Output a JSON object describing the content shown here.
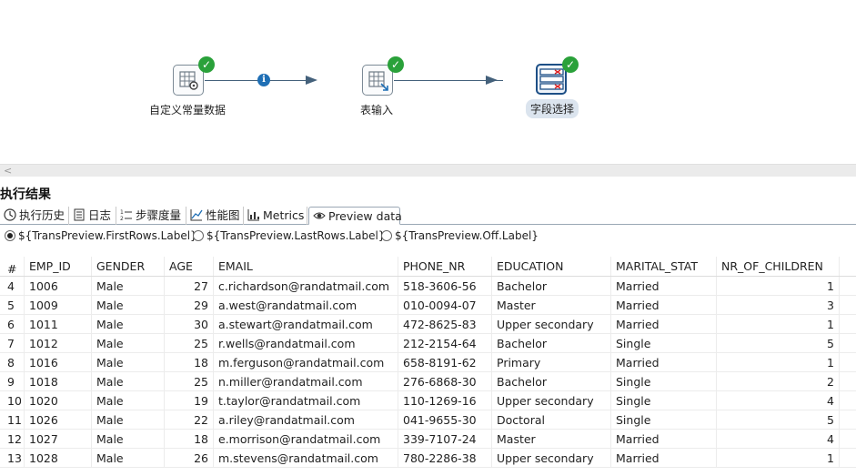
{
  "canvas": {
    "steps": [
      {
        "label": "自定义常量数据",
        "icon": "data-grid-gear-icon",
        "status": "check-icon"
      },
      {
        "label": "表输入",
        "icon": "table-input-icon",
        "status": "check-icon"
      },
      {
        "label": "字段选择",
        "icon": "select-values-icon",
        "status": "check-icon"
      }
    ],
    "hop_badge": "i"
  },
  "divider": {
    "collapse_glyph": "<"
  },
  "panel": {
    "title": "执行结果",
    "tabs": [
      {
        "label": "执行历史",
        "icon": "history-icon"
      },
      {
        "label": "日志",
        "icon": "log-icon"
      },
      {
        "label": "步骤度量",
        "icon": "step-metrics-icon"
      },
      {
        "label": "性能图",
        "icon": "performance-chart-icon"
      },
      {
        "label": "Metrics",
        "icon": "metrics-icon"
      },
      {
        "label": "Preview data",
        "icon": "eye-icon"
      }
    ],
    "active_tab": "Preview data",
    "radios": [
      {
        "label": "${TransPreview.FirstRows.Label}",
        "checked": true
      },
      {
        "label": "${TransPreview.LastRows.Label}",
        "checked": false
      },
      {
        "label": "${TransPreview.Off.Label}",
        "checked": false
      }
    ]
  },
  "table": {
    "columns": [
      "#",
      "EMP_ID",
      "GENDER",
      "AGE",
      "EMAIL",
      "PHONE_NR",
      "EDUCATION",
      "MARITAL_STAT",
      "NR_OF_CHILDREN"
    ],
    "rows": [
      [
        "4",
        "1006",
        "Male",
        "27",
        "c.richardson@randatmail.com",
        "518-3606-56",
        "Bachelor",
        "Married",
        "1"
      ],
      [
        "5",
        "1009",
        "Male",
        "29",
        "a.west@randatmail.com",
        "010-0094-07",
        "Master",
        "Married",
        "3"
      ],
      [
        "6",
        "1011",
        "Male",
        "30",
        "a.stewart@randatmail.com",
        "472-8625-83",
        "Upper secondary",
        "Married",
        "1"
      ],
      [
        "7",
        "1012",
        "Male",
        "25",
        "r.wells@randatmail.com",
        "212-2154-64",
        "Bachelor",
        "Single",
        "5"
      ],
      [
        "8",
        "1016",
        "Male",
        "18",
        "m.ferguson@randatmail.com",
        "658-8191-62",
        "Primary",
        "Married",
        "1"
      ],
      [
        "9",
        "1018",
        "Male",
        "25",
        "n.miller@randatmail.com",
        "276-6868-30",
        "Bachelor",
        "Single",
        "2"
      ],
      [
        "10",
        "1020",
        "Male",
        "19",
        "t.taylor@randatmail.com",
        "110-1269-16",
        "Upper secondary",
        "Single",
        "4"
      ],
      [
        "11",
        "1026",
        "Male",
        "22",
        "a.riley@randatmail.com",
        "041-9655-30",
        "Doctoral",
        "Single",
        "5"
      ],
      [
        "12",
        "1027",
        "Male",
        "18",
        "e.morrison@randatmail.com",
        "339-7107-24",
        "Master",
        "Married",
        "4"
      ],
      [
        "13",
        "1028",
        "Male",
        "26",
        "m.stevens@randatmail.com",
        "780-2286-38",
        "Upper secondary",
        "Married",
        "1"
      ]
    ]
  },
  "colors": {
    "hop": "#44617b",
    "check": "#2aa13a",
    "info": "#1f6fb5",
    "selected_step": "#1d4f86"
  }
}
